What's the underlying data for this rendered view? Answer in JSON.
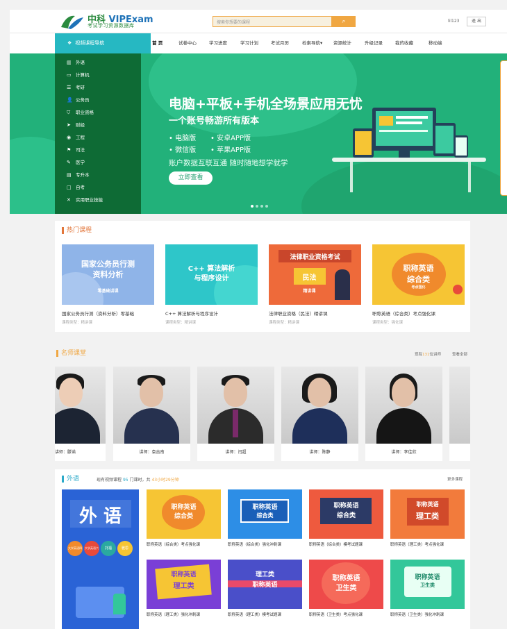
{
  "header": {
    "logo_cn": "中科",
    "logo_en": "VIPExam",
    "logo_tagline": "考试学习资源数据库",
    "search_placeholder": "搜索你想要的课程",
    "search_icon": "magnifier-icon",
    "username": "lil123",
    "logout_label": "退 出"
  },
  "nav": {
    "category_label": "视频课程导航",
    "items": [
      "首 页",
      "试卷中心",
      "学习进度",
      "学习计划",
      "考试月历",
      "检索导航▾",
      "资源统计",
      "升级记录",
      "我的收藏",
      "移动端"
    ]
  },
  "sidebar": {
    "items": [
      {
        "icon": "book-icon",
        "label": "外语"
      },
      {
        "icon": "monitor-icon",
        "label": "计算机"
      },
      {
        "icon": "list-icon",
        "label": "考研"
      },
      {
        "icon": "person-icon",
        "label": "公务员"
      },
      {
        "icon": "shield-icon",
        "label": "职业资格"
      },
      {
        "icon": "send-icon",
        "label": "财经"
      },
      {
        "icon": "circle-icon",
        "label": "工程"
      },
      {
        "icon": "gavel-icon",
        "label": "司法"
      },
      {
        "icon": "pen-icon",
        "label": "医学"
      },
      {
        "icon": "doc-icon",
        "label": "专升本"
      },
      {
        "icon": "square-icon",
        "label": "自考"
      },
      {
        "icon": "tools-icon",
        "label": "实用职业技能"
      }
    ]
  },
  "banner": {
    "title": "电脑+平板+手机全场景应用无忧",
    "subtitle": "一个账号畅游所有版本",
    "features": [
      "• 电脑版",
      "• 安卓APP版",
      "• 微信版",
      "• 苹果APP版"
    ],
    "line": "账户数据互联互通 随时随地想学就学",
    "button": "立即查看"
  },
  "hot_courses": {
    "title": "热门课程",
    "items": [
      {
        "thumb_line1": "国家公务员行测",
        "thumb_line2": "资料分析",
        "thumb_line3": "零基础讲课",
        "name": "国家公务员行测（资料分析）零基础",
        "meta": "课程类型：精讲课",
        "bg": "#8fb4e8"
      },
      {
        "thumb_line1": "C++ 算法解析",
        "thumb_line2": "与程序设计",
        "thumb_line3": "",
        "name": "C++ 算法解析与程序设计",
        "meta": "课程类型：精讲课",
        "bg": "#2ec6c9"
      },
      {
        "thumb_line1": "法律职业资格考试",
        "thumb_line2": "民法",
        "thumb_line3": "精讲课",
        "name": "法律职业资格（民法）精讲课",
        "meta": "课程类型：精讲课",
        "bg": "#ee6a3a"
      },
      {
        "thumb_line1": "职称英语",
        "thumb_line2": "综合类",
        "thumb_line3": "考点强化",
        "name": "职称英语（综合类）考点强化课",
        "meta": "课程类型：强化课",
        "bg": "#f6c534"
      }
    ]
  },
  "teachers": {
    "title": "名师课堂",
    "count_prefix": "现有",
    "count": "131",
    "count_suffix": "位讲师",
    "view_all": "查看全部",
    "items": [
      "讲师：滕诺",
      "讲师：袁吉南",
      "讲师：闫超",
      "讲师：陈静",
      "讲师：李佳欣"
    ]
  },
  "foreign": {
    "title": "外语",
    "stat_prefix": "现有视频课程",
    "count": "95",
    "stat_mid": "门课时，共",
    "duration": "43小时29分钟",
    "more": "更多课程",
    "cover_title": "外 语",
    "cover_tags": [
      "大学英语四级",
      "大学英语六级",
      "托福",
      "雅思"
    ],
    "courses": [
      {
        "line1": "职称英语",
        "line2": "综合类",
        "name": "职称英语（综合类）考点强化课",
        "bg": "#f6c534",
        "fg": "#d6453a"
      },
      {
        "line1": "职称英语",
        "line2": "综合类",
        "name": "职称英语（综合类）强化冲刺课",
        "bg": "#2d8ee6",
        "fg": "#ffffff"
      },
      {
        "line1": "职称英语",
        "line2": "综合类",
        "name": "职称英语（综合类）模考试题课",
        "bg": "#ee5a3e",
        "fg": "#ffffff"
      },
      {
        "line1": "职称英语",
        "line2": "理工类",
        "name": "职称英语（理工类）考点强化课",
        "bg": "#f27b3c",
        "fg": "#ffffff"
      },
      {
        "line1": "职称英语",
        "line2": "理工类",
        "name": "职称英语（理工类）强化冲刺课",
        "bg": "#7a3fd6",
        "fg": "#ffffff"
      },
      {
        "line1": "理工类",
        "line2": "职称英语",
        "name": "职称英语（理工类）模考试题课",
        "bg": "#4a4fc9",
        "fg": "#ffffff"
      },
      {
        "line1": "职称英语",
        "line2": "卫生类",
        "name": "职称英语（卫生类）考点强化课",
        "bg": "#ee4a4a",
        "fg": "#ffffff"
      },
      {
        "line1": "职称英语",
        "line2": "卫生类",
        "name": "职称英语（卫生类）强化冲刺课",
        "bg": "#33c79a",
        "fg": "#ffffff"
      }
    ]
  }
}
